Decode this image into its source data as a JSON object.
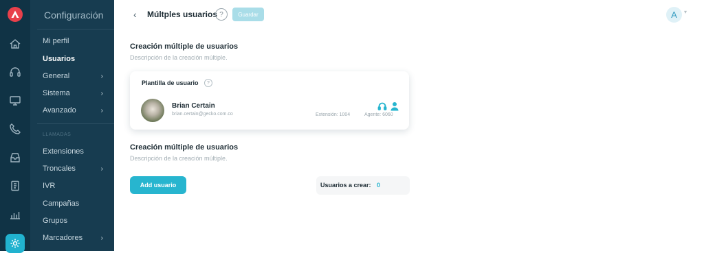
{
  "sidebar": {
    "title": "Configuración",
    "items": [
      {
        "label": "Mi perfil"
      },
      {
        "label": "Usuarios"
      },
      {
        "label": "General"
      },
      {
        "label": "Sistema"
      },
      {
        "label": "Avanzado"
      },
      {
        "label": "Extensiones"
      },
      {
        "label": "Troncales"
      },
      {
        "label": "IVR"
      },
      {
        "label": "Campañas"
      },
      {
        "label": "Grupos"
      },
      {
        "label": "Marcadores"
      }
    ],
    "section_label": "LLAMADAS"
  },
  "header": {
    "title": "Múltples usuarios",
    "help": "?",
    "save_label": "Guardar",
    "avatar_letter": "A"
  },
  "main": {
    "section1": {
      "title": "Creación múltiple de usuarios",
      "description": "Descripción de la creación múltiple."
    },
    "template_card": {
      "title": "Plantilla de usuario",
      "help": "?",
      "user_name": "Brian Certain",
      "user_email": "brian.certain@gecko.com.co",
      "extension": "Extensión: 1004",
      "agent": "Agente: 6060"
    },
    "section2": {
      "title": "Creación múltiple de usuarios",
      "description": "Descripción de la creación múltiple."
    },
    "add_button_label": "Add usuario",
    "count_label": "Usuarios a crear:",
    "count_value": "0"
  },
  "colors": {
    "rail": "#103345",
    "sidebar": "#173c50",
    "accent": "#27b5cf",
    "logo": "#e8404b"
  }
}
